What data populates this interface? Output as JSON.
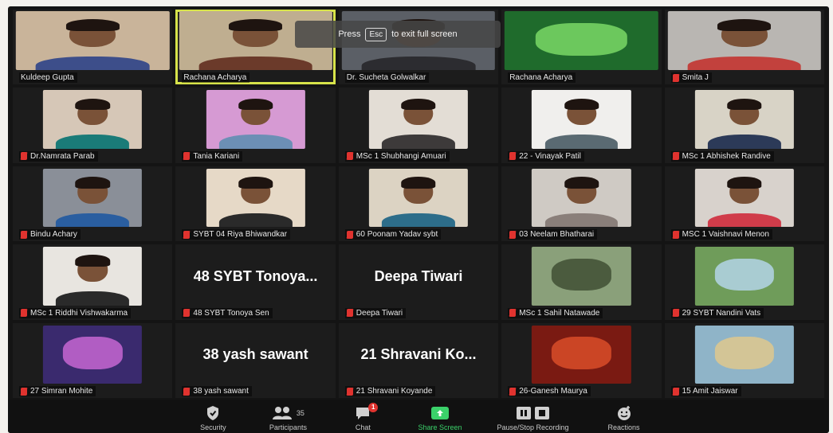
{
  "window": {
    "fullscreen_hint": {
      "prefix": "Press",
      "key": "Esc",
      "suffix": "to exit full screen"
    }
  },
  "participants": [
    {
      "name": "Kuldeep Gupta",
      "type": "video",
      "bg": "#c9b49a",
      "shirt": "#3d4e8a"
    },
    {
      "name": "Rachana Acharya",
      "type": "video",
      "bg": "#bfae90",
      "shirt": "#6b3a2a",
      "active": true
    },
    {
      "name": "Dr. Sucheta Golwalkar",
      "type": "video",
      "bg": "#5b5f66",
      "shirt": "#2c2c30"
    },
    {
      "name": "Rachana Acharya",
      "type": "image",
      "bg": "#1f6b2c",
      "accent": "#7fe06a"
    },
    {
      "name": "Smita J",
      "type": "video",
      "bg": "#b9b6b2",
      "shirt": "#c2413d"
    },
    {
      "name": "Dr.Namrata Parab",
      "type": "video",
      "bg": "#d6c7b7",
      "shirt": "#1a7b78"
    },
    {
      "name": "Tania Kariani",
      "type": "video",
      "bg": "#d69ad3",
      "shirt": "#6c8fb5"
    },
    {
      "name": "MSc 1 Shubhangi Amuari",
      "type": "video",
      "bg": "#e3ddd5",
      "shirt": "#3d3a3a"
    },
    {
      "name": "22 - Vinayak Patil",
      "type": "video",
      "bg": "#f0efed",
      "shirt": "#5a6a72"
    },
    {
      "name": "MSc 1 Abhishek Randive",
      "type": "video",
      "bg": "#d8d3c6",
      "shirt": "#2c3a58"
    },
    {
      "name": "Bindu Achary",
      "type": "video",
      "bg": "#8a8f98",
      "shirt": "#2a5ea0"
    },
    {
      "name": "SYBT 04 Riya Bhiwandkar",
      "type": "video",
      "bg": "#e6d9c7",
      "shirt": "#2a2a2a"
    },
    {
      "name": "60 Poonam Yadav sybt",
      "type": "video",
      "bg": "#dcd3c3",
      "shirt": "#2d6d8a"
    },
    {
      "name": "03 Neelam Bhatharai",
      "type": "video",
      "bg": "#cfcac4",
      "shirt": "#8a7f7a"
    },
    {
      "name": "MSC 1 Vaishnavi Menon",
      "type": "video",
      "bg": "#d8d2cc",
      "shirt": "#d03c4a"
    },
    {
      "name": "MSc 1 Riddhi Vishwakarma",
      "type": "video",
      "bg": "#e8e5e0",
      "shirt": "#2a2a2a"
    },
    {
      "name": "48 SYBT Tonoya Sen",
      "type": "name",
      "display": "48 SYBT Tonoya..."
    },
    {
      "name": "Deepa Tiwari",
      "type": "name",
      "display": "Deepa Tiwari"
    },
    {
      "name": "MSc 1 Sahil Natawade",
      "type": "image",
      "bg": "#8aa07a",
      "accent": "#3b4a30"
    },
    {
      "name": "29 SYBT Nandini Vats",
      "type": "image",
      "bg": "#6f9c5a",
      "accent": "#b8d8f0"
    },
    {
      "name": "27 Simran Mohite",
      "type": "image",
      "bg": "#3a2a6e",
      "accent": "#d06ad8"
    },
    {
      "name": "38 yash sawant",
      "type": "name",
      "display": "38 yash sawant"
    },
    {
      "name": "21 Shravani Koyande",
      "type": "name",
      "display": "21 Shravani Ko..."
    },
    {
      "name": "26-Ganesh Maurya",
      "type": "image",
      "bg": "#7a1a12",
      "accent": "#e0502a"
    },
    {
      "name": "15 Amit Jaiswar",
      "type": "image",
      "bg": "#8fb4c8",
      "accent": "#e3c98a"
    }
  ],
  "toolbar": {
    "security": "Security",
    "participants": "Participants",
    "participants_count": "35",
    "chat": "Chat",
    "chat_badge": "1",
    "share_screen": "Share Screen",
    "recording": "Pause/Stop Recording",
    "reactions": "Reactions"
  },
  "colors": {
    "active_speaker": "#d7e34a",
    "share_green": "#3bd16a",
    "muted_red": "#e0332f"
  }
}
